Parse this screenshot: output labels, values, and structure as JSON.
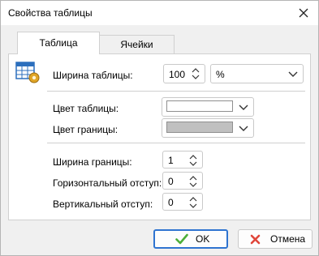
{
  "window": {
    "title": "Свойства таблицы"
  },
  "tabs": [
    {
      "label": "Таблица"
    },
    {
      "label": "Ячейки"
    }
  ],
  "table_width": {
    "label": "Ширина таблицы:",
    "value": "100",
    "unit": "%"
  },
  "table_color": {
    "label": "Цвет таблицы:",
    "color": "#ffffff"
  },
  "border_color": {
    "label": "Цвет границы:",
    "color": "#c0c0c0"
  },
  "border_width": {
    "label": "Ширина границы:",
    "value": "1"
  },
  "h_padding": {
    "label": "Горизонтальный отступ:",
    "value": "0"
  },
  "v_padding": {
    "label": "Вертикальный отступ:",
    "value": "0"
  },
  "buttons": {
    "ok": "OK",
    "cancel": "Отмена"
  },
  "colors": {
    "accent": "#2f74d0",
    "ok_check": "#4caf3a",
    "cancel_x": "#e0463a"
  }
}
